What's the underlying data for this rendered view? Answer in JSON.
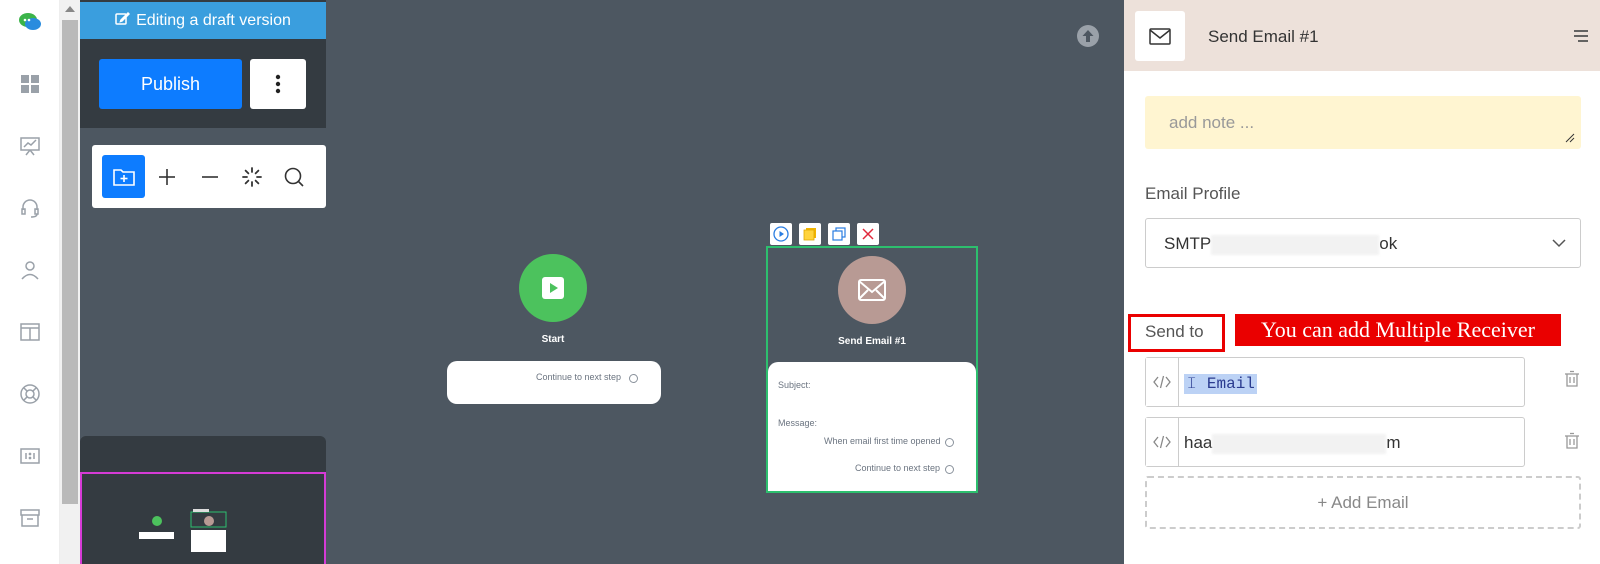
{
  "rail": {
    "icons": [
      "chat-logo-icon",
      "dashboard-icon",
      "presentation-icon",
      "headset-icon",
      "user-icon",
      "layout-icon",
      "lifebuoy-icon",
      "ratio-icon",
      "archive-icon"
    ]
  },
  "editor": {
    "draft_banner": "Editing a draft version",
    "publish_label": "Publish",
    "toolbar_tools": [
      "add-folder-icon",
      "zoom-in-icon",
      "zoom-out-icon",
      "loading-icon",
      "search-icon"
    ]
  },
  "canvas": {
    "start_node": {
      "label": "Start",
      "output": "Continue to next step",
      "color": "#4cc25d"
    },
    "email_node": {
      "label": "Send Email #1",
      "subject_label": "Subject:",
      "message_label": "Message:",
      "output_opened": "When email first time opened",
      "output_next": "Continue to next step",
      "color": "#b89a94"
    }
  },
  "panel": {
    "title": "Send Email #1",
    "note_placeholder": "add note ...",
    "email_profile_label": "Email Profile",
    "email_profile_value_start": "SMTP",
    "email_profile_value_end": "ok",
    "send_to_label": "Send to",
    "annotation": "You can add Multiple Receiver",
    "receivers": [
      {
        "value": "Email",
        "type": "token"
      },
      {
        "value_start": "haa",
        "value_end": "m",
        "type": "text"
      }
    ],
    "add_email_label": "+ Add Email"
  },
  "colors": {
    "accent": "#0d7cff",
    "canvas_bg": "#4d5761",
    "highlight_red": "#ea0000"
  }
}
